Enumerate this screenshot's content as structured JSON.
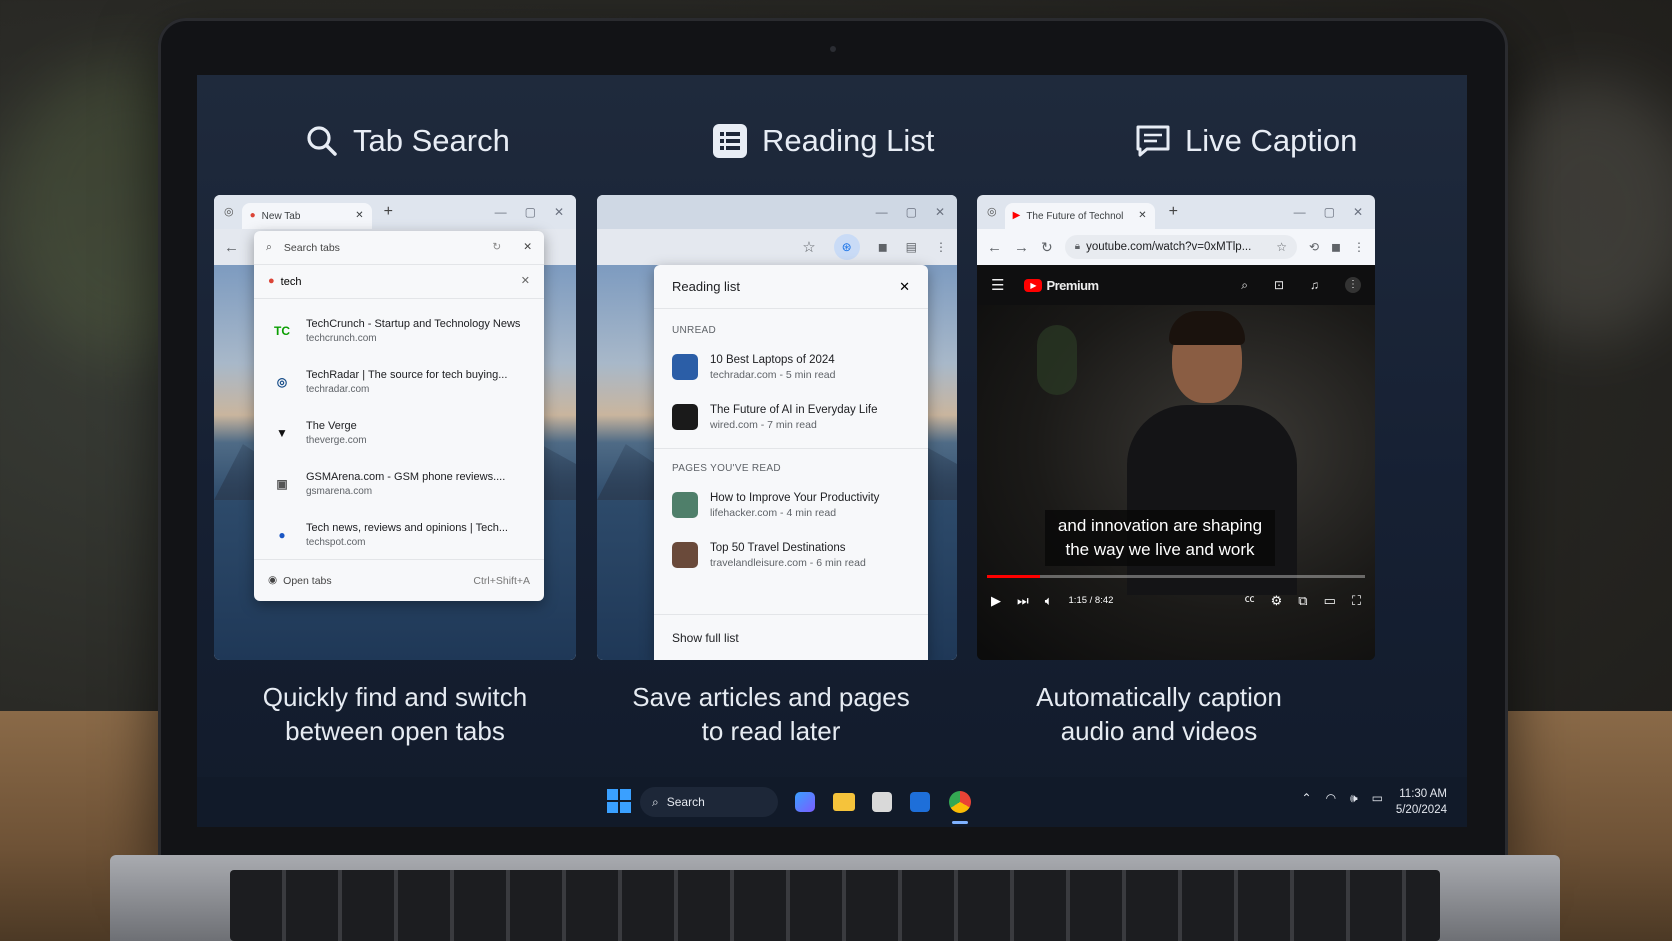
{
  "features": [
    {
      "title": "Tab Search",
      "icon": "search-icon",
      "caption_line1": "Quickly find and switch",
      "caption_line2": "between open tabs"
    },
    {
      "title": "Reading List",
      "icon": "reading-list-icon",
      "caption_line1": "Save articles and pages",
      "caption_line2": "to read later"
    },
    {
      "title": "Live Caption",
      "icon": "caption-icon",
      "caption_line1": "Automatically caption",
      "caption_line2": "audio and videos"
    }
  ],
  "tab_search": {
    "tab_label": "New Tab",
    "search_placeholder": "Search tabs",
    "query": "tech",
    "results": [
      {
        "title": "TechCrunch - Startup and Technology News",
        "url": "techcrunch.com",
        "icon": "TC",
        "color": "#0a9e01"
      },
      {
        "title": "TechRadar | The source for tech buying...",
        "url": "techradar.com",
        "icon": "◎",
        "color": "#1a4f8a"
      },
      {
        "title": "The Verge",
        "url": "theverge.com",
        "icon": "▼",
        "color": "#111111"
      },
      {
        "title": "GSMArena.com - GSM phone reviews....",
        "url": "gsmarena.com",
        "icon": "▣",
        "color": "#555555"
      },
      {
        "title": "Tech news, reviews and opinions | Tech...",
        "url": "techspot.com",
        "icon": "●",
        "color": "#1a56c4"
      }
    ],
    "footer_label": "Open tabs",
    "footer_shortcut": "Ctrl+Shift+A"
  },
  "reading_list": {
    "title": "Reading list",
    "unread_header": "UNREAD",
    "unread": [
      {
        "title": "10 Best Laptops of 2024",
        "meta": "techradar.com - 5 min read",
        "color": "#2b5ea7"
      },
      {
        "title": "The Future of AI in Everyday Life",
        "meta": "wired.com - 7 min read",
        "color": "#1a1a1a"
      }
    ],
    "read_header": "PAGES YOU'VE READ",
    "read": [
      {
        "title": "How to Improve Your Productivity",
        "meta": "lifehacker.com - 4 min read",
        "color": "#4f7f6a"
      },
      {
        "title": "Top 50 Travel Destinations",
        "meta": "travelandleisure.com - 6 min read",
        "color": "#6a4a3a"
      }
    ],
    "show_full": "Show full list"
  },
  "live_caption": {
    "tab_label": "The Future of Technol",
    "url": "youtube.com/watch?v=0xMTlp...",
    "brand": "Premium",
    "caption_line1": "and innovation are shaping",
    "caption_line2": "the way we live and work",
    "time": "1:15 / 8:42",
    "progress": 0.14
  },
  "taskbar": {
    "search_label": "Search",
    "time": "11:30 AM",
    "date": "5/20/2024"
  },
  "colors": {
    "accent": "#1a73e8",
    "youtube_red": "#ff0000",
    "screen_bg": "#18223a"
  }
}
